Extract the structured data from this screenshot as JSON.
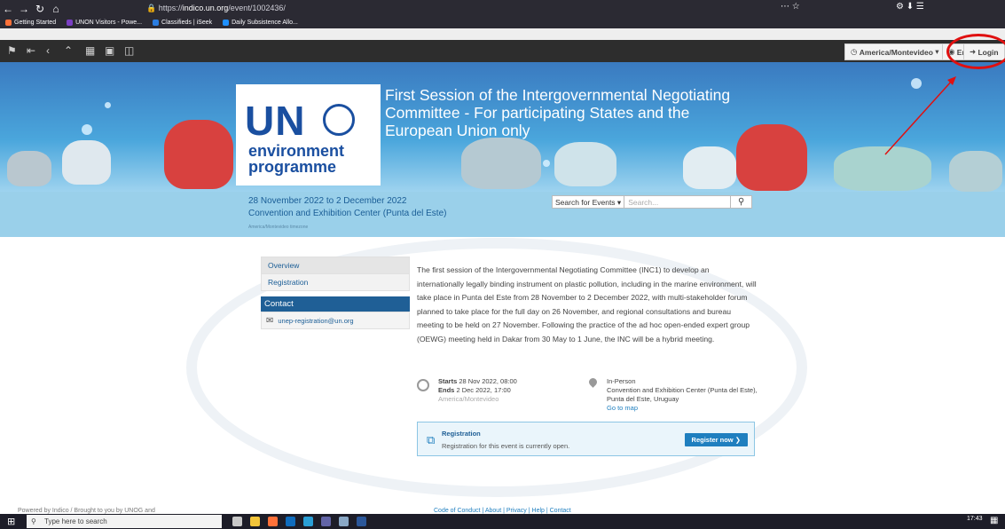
{
  "browser": {
    "url_prefix": "https://",
    "url_host": "indico.un.org",
    "url_path": "/event/1002436/",
    "bookmarks": [
      {
        "label": "Getting Started",
        "color": "#ff7139"
      },
      {
        "label": "UNON Visitors - Powe...",
        "color": "#7b3fc4"
      },
      {
        "label": "Classifieds | iSeek",
        "color": "#2a7de1"
      },
      {
        "label": "Daily Subsistence Allo...",
        "color": "#1e90ff"
      }
    ]
  },
  "toolbar": {
    "timezone_label": "America/Montevideo",
    "language_label": "English",
    "login_label": "Login"
  },
  "event": {
    "title": "First Session of the Intergovernmental Negotiating Committee - For participating States and the European Union only",
    "logo_un": "UN",
    "logo_env": "environment",
    "logo_prog": "programme",
    "dates": "28 November 2022 to 2 December 2022",
    "venue": "Convention and Exhibition Center (Punta del Este)",
    "timezone_note": "America/Montevideo timezone"
  },
  "search": {
    "scope_label": "Search for Events",
    "placeholder": "Search..."
  },
  "menu": {
    "items": [
      "Overview",
      "Registration"
    ],
    "contact_title": "Contact",
    "contact_email": "unep-registration@un.org"
  },
  "description": "The first session of the Intergovernmental Negotiating Committee (INC1) to develop an internationally legally binding instrument on plastic pollution, including in the marine environment, will take place in Punta del Este from 28 November to 2 December 2022, with multi-stakeholder forum planned to take place for the full day on 26 November, and regional consultations and bureau meeting to be held on 27 November. Following the practice of the ad hoc open-ended expert group (OEWG) meeting held in Dakar from 30 May to 1 June, the INC will be a hybrid meeting.",
  "times": {
    "starts_label": "Starts",
    "starts_value": "28 Nov 2022, 08:00",
    "ends_label": "Ends",
    "ends_value": "2 Dec 2022, 17:00",
    "tz": "America/Montevideo"
  },
  "location": {
    "mode": "In-Person",
    "place": "Convention and Exhibition Center (Punta del Este), Punta del Este, Uruguay",
    "map_link": "Go to map"
  },
  "registration": {
    "title": "Registration",
    "status": "Registration for this event is currently open.",
    "button": "Register now"
  },
  "footer": {
    "left": "Powered by Indico / Brought to you by UNOG and",
    "right": "Code of Conduct | About | Privacy | Help | Contact"
  },
  "taskbar": {
    "search_placeholder": "Type here to search",
    "time": "17:43"
  },
  "colors": {
    "annotation": "#e01010",
    "brand_blue": "#1f5f96"
  }
}
